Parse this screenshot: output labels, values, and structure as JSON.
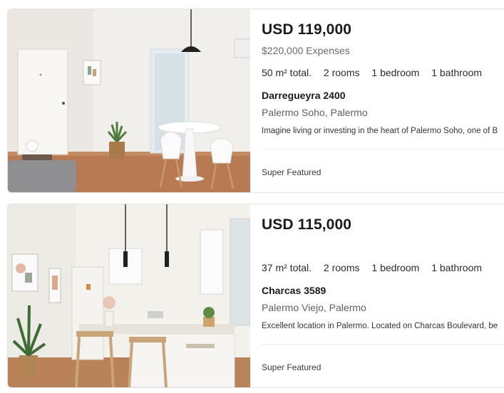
{
  "listings": [
    {
      "price": "USD 119,000",
      "expenses": "$220,000 Expenses",
      "features": [
        "50 m² total.",
        "2 rooms",
        "1 bedroom",
        "1 bathroom"
      ],
      "address": "Darregueyra 2400",
      "location": "Palermo Soho, Palermo",
      "description": "Imagine living or investing in the heart of Palermo Soho, one of B",
      "badge": "Super Featured"
    },
    {
      "price": "USD 115,000",
      "expenses": "",
      "features": [
        "37 m² total.",
        "2 rooms",
        "1 bedroom",
        "1 bathroom"
      ],
      "address": "Charcas 3589",
      "location": "Palermo Viejo, Palermo",
      "description": "Excellent location in Palermo. Located on Charcas Boulevard, be",
      "badge": "Super Featured"
    }
  ]
}
